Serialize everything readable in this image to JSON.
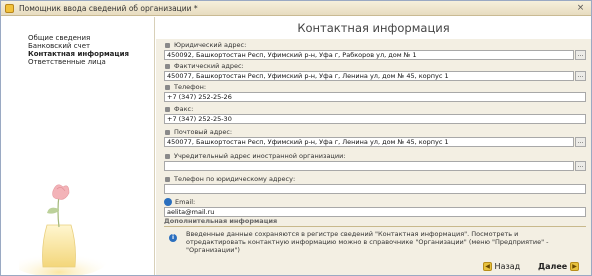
{
  "window": {
    "title": "Помощник ввода сведений об организации *",
    "close_glyph": "×"
  },
  "sidebar": {
    "items": [
      {
        "label": "Общие сведения"
      },
      {
        "label": "Банковский счет"
      },
      {
        "label": "Контактная информация"
      },
      {
        "label": "Ответственные лица"
      }
    ]
  },
  "main": {
    "heading": "Контактная информация",
    "fields": {
      "legal": {
        "label": "Юридический адрес:",
        "value": "450092, Башкортостан Респ, Уфимский р-н, Уфа г, Рабкоров ул, дом № 1"
      },
      "actual": {
        "label": "Фактический адрес:",
        "value": "450077, Башкортостан Респ, Уфимский р-н, Уфа г, Ленина ул, дом № 45, корпус 1"
      },
      "phone": {
        "label": "Телефон:",
        "value": "+7 (347) 252-25-26"
      },
      "fax": {
        "label": "Факс:",
        "value": "+7 (347) 252-25-30"
      },
      "postal": {
        "label": "Почтовый адрес:",
        "value": "450077, Башкортостан Респ, Уфимский р-н, Уфа г, Ленина ул, дом № 45, корпус 1"
      },
      "foreign": {
        "label": "Учредительный адрес иностранной организации:",
        "value": ""
      },
      "legal_phone": {
        "label": "Телефон по юридическому адресу:",
        "value": ""
      },
      "email": {
        "label": "Email:",
        "value": "aelita@mail.ru"
      }
    },
    "dots_glyph": "...",
    "info": {
      "title": "Дополнительная информация",
      "icon_glyph": "i",
      "text": "Введенные данные сохраняются в регистре сведений \"Контактная информация\". Посмотреть и отредактировать контактную информацию можно в справочнике \"Организации\" (меню \"Предприятие\" - \"Организации\")"
    }
  },
  "footer": {
    "back_label": "Назад",
    "next_label": "Далее",
    "back_glyph": "◀",
    "next_glyph": "▶"
  },
  "colors": {
    "titlebar": "#efe6cc",
    "content_bg": "#f3efe3",
    "accent_blue": "#2b6fbe",
    "nav_arrow": "#e8c23e"
  },
  "icons": [
    "app-icon",
    "close-icon",
    "field-pin-icon",
    "email-icon",
    "info-icon",
    "back-arrow-icon",
    "next-arrow-icon",
    "flower-vase-illustration"
  ]
}
